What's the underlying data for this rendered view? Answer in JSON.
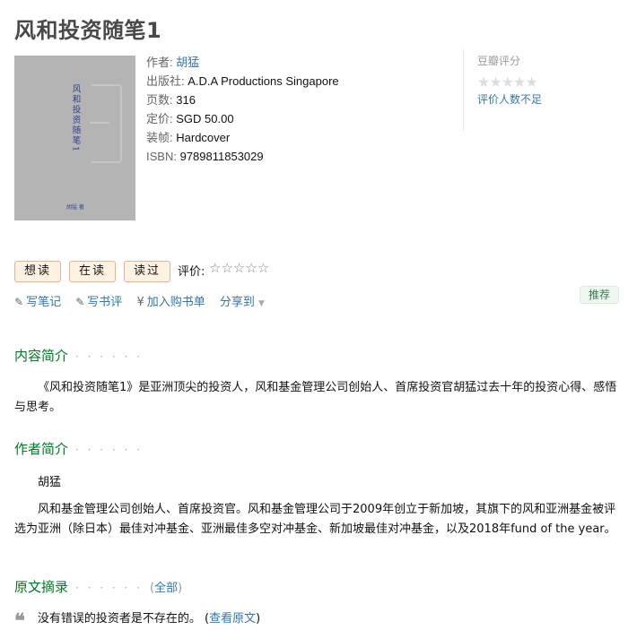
{
  "book": {
    "title": "风和投资随笔1",
    "cover": {
      "title_vertical": "风和投资随笔1",
      "author": "胡猛 著"
    },
    "info": {
      "author_label": "作者:",
      "author": "胡猛",
      "publisher_label": "出版社:",
      "publisher": "A.D.A Productions Singapore",
      "pages_label": "页数:",
      "pages": "316",
      "price_label": "定价:",
      "price": "SGD 50.00",
      "binding_label": "装帧:",
      "binding": "Hardcover",
      "isbn_label": "ISBN:",
      "isbn": "9789811853029"
    }
  },
  "rating": {
    "title": "豆瓣评分",
    "stars": "★★★★★",
    "not_enough": "评价人数不足"
  },
  "buttons": {
    "want": "想读",
    "reading": "在读",
    "read": "读过",
    "rate_label": "评价:",
    "rate_stars": "☆☆☆☆☆"
  },
  "actions": {
    "write_note": "写笔记",
    "write_review": "写书评",
    "add_cart": "加入购书单",
    "share": "分享到",
    "recommend": "推荐"
  },
  "sections": {
    "intro": {
      "heading": "内容简介",
      "dots": "· · · · · ·",
      "text": "《风和投资随笔1》是亚洲顶尖的投资人，风和基金管理公司创始人、首席投资官胡猛过去十年的投资心得、感悟与思考。"
    },
    "author": {
      "heading": "作者简介",
      "dots": "· · · · · ·",
      "name": "胡猛",
      "text": "风和基金管理公司创始人、首席投资官。风和基金管理公司于2009年创立于新加坡，其旗下的风和亚洲基金被评选为亚洲（除日本）最佳对冲基金、亚洲最佳多空对冲基金、新加坡最佳对冲基金，以及2018年fund of the year。"
    },
    "excerpt": {
      "heading": "原文摘录",
      "dots": "· · · · · ·",
      "all_open": "(",
      "all": "全部",
      "all_close": ")",
      "quote_mark": "❝",
      "quote": "没有错误的投资者是不存在的。",
      "view_open": "(",
      "view": "查看原文",
      "view_close": ")"
    }
  }
}
